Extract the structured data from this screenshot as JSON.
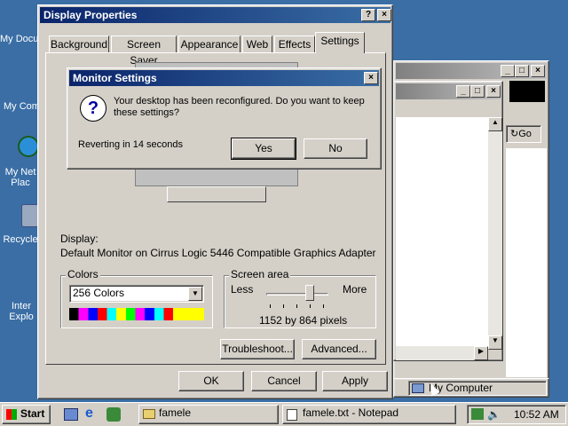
{
  "desktop": {
    "icons": [
      "My Docu",
      "My Com",
      "My Net\nPlac",
      "Recycle",
      "Inter\nExplo"
    ]
  },
  "display_properties": {
    "title": "Display Properties",
    "tabs": [
      "Background",
      "Screen Saver",
      "Appearance",
      "Web",
      "Effects",
      "Settings"
    ],
    "display_label": "Display:",
    "display_value": "Default Monitor on Cirrus Logic 5446 Compatible Graphics Adapter",
    "colors": {
      "title": "Colors",
      "value": "256 Colors"
    },
    "screen_area": {
      "title": "Screen area",
      "less": "Less",
      "more": "More",
      "value": "1152 by 864 pixels"
    },
    "buttons": {
      "troubleshoot": "Troubleshoot...",
      "advanced": "Advanced...",
      "ok": "OK",
      "cancel": "Cancel",
      "apply": "Apply"
    }
  },
  "monitor_dialog": {
    "title": "Monitor Settings",
    "message": "Your desktop has been reconfigured.  Do you want to keep these settings?",
    "countdown": "Reverting in 14 seconds",
    "yes": "Yes",
    "no": "No"
  },
  "explorer": {
    "go": "Go",
    "status": "My Computer"
  },
  "taskbar": {
    "start": "Start",
    "tasks": [
      "famele",
      "famele.txt - Notepad"
    ],
    "clock": "10:52 AM"
  }
}
